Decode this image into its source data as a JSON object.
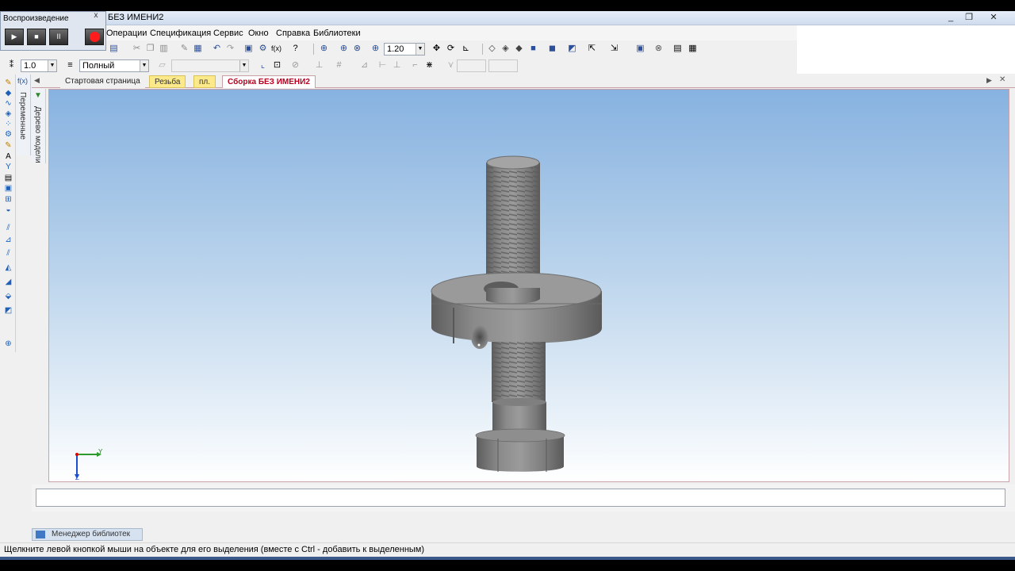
{
  "window": {
    "title": "БЕЗ ИМЕНИ2",
    "controls": [
      "_",
      "❐",
      "✕"
    ]
  },
  "playback": {
    "title": "Воспроизведение",
    "close": "x",
    "buttons": [
      "▶",
      "■",
      "II"
    ]
  },
  "menu": {
    "items": [
      "Операции",
      "Спецификация",
      "Сервис",
      "Окно",
      "Справка",
      "Библиотеки"
    ]
  },
  "toolbar": {
    "zoom_value": "1.20",
    "step_value": "1.0",
    "style_value": "Полный"
  },
  "tabs": [
    {
      "label": "Стартовая страница",
      "style": "plain"
    },
    {
      "label": "Резьба",
      "style": "yellow"
    },
    {
      "label": "пл.",
      "style": "yellow"
    },
    {
      "label": "Сборка БЕЗ ИМЕНИ2",
      "style": "active"
    }
  ],
  "side_panels": {
    "variables": "Переменные",
    "model_tree": "Дерево модели"
  },
  "axes": {
    "y": "Y",
    "z": "Z"
  },
  "library_manager": "Менеджер библиотек",
  "status": "Щелкните левой кнопкой мыши на объекте для его выделения (вместе с Ctrl - добавить к выделенным)",
  "colors": {
    "active_tab": "#b8001f",
    "viewport_top": "#87b2e0",
    "record": "#ff1c1c"
  }
}
